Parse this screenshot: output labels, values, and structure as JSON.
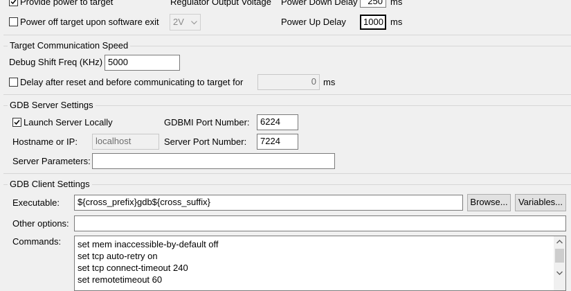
{
  "power": {
    "provide_power_label": "Provide power to target",
    "provide_power_checked": true,
    "regulator_voltage_label": "Regulator Output Voltage",
    "power_down_delay_label": "Power Down Delay",
    "power_down_delay_value": "250",
    "power_down_delay_unit": "ms",
    "power_off_label": "Power off target upon software exit",
    "power_off_checked": false,
    "voltage_selected": "2V",
    "power_up_delay_label": "Power Up Delay",
    "power_up_delay_value": "1000",
    "power_up_delay_unit": "ms"
  },
  "speed": {
    "group_title": "Target Communication Speed",
    "debug_shift_label": "Debug Shift Freq (KHz)",
    "debug_shift_value": "5000",
    "delay_after_reset_label": "Delay after reset and before communicating to target for",
    "delay_after_reset_checked": false,
    "delay_value": "0",
    "delay_unit": "ms"
  },
  "gdb_server": {
    "group_title": "GDB Server Settings",
    "launch_locally_label": "Launch Server Locally",
    "launch_locally_checked": true,
    "gdbmi_port_label": "GDBMI Port Number:",
    "gdbmi_port_value": "6224",
    "hostname_label": "Hostname or IP:",
    "hostname_value": "localhost",
    "server_port_label": "Server Port Number:",
    "server_port_value": "7224",
    "server_params_label": "Server Parameters:",
    "server_params_value": ""
  },
  "gdb_client": {
    "group_title": "GDB Client Settings",
    "executable_label": "Executable:",
    "executable_value": "${cross_prefix}gdb${cross_suffix}",
    "browse_label": "Browse...",
    "variables_label": "Variables...",
    "other_options_label": "Other options:",
    "other_options_value": "",
    "commands_label": "Commands:",
    "commands": [
      "set mem inaccessible-by-default off",
      "set tcp auto-retry on",
      "set tcp connect-timeout 240",
      "set remotetimeout 60"
    ]
  }
}
